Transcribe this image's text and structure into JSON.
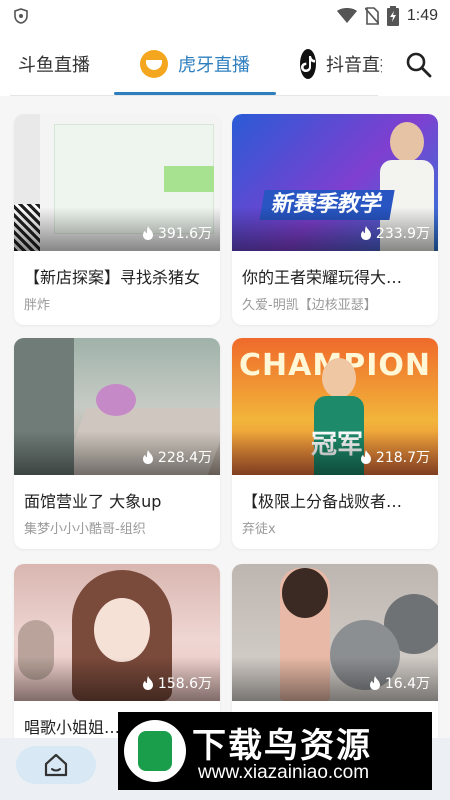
{
  "status_bar": {
    "time": "1:49",
    "icons": [
      "shield-icon",
      "wifi-icon",
      "no-sim-icon",
      "battery-charging-icon"
    ]
  },
  "tabs": [
    {
      "label": "斗鱼直播",
      "icon": "",
      "selected": false
    },
    {
      "label": "虎牙直播",
      "icon": "huya-logo-icon",
      "selected": true
    },
    {
      "label": "抖音直播",
      "icon": "douyin-logo-icon",
      "selected": false
    }
  ],
  "search": {
    "icon": "search-icon"
  },
  "accent_color": "#2f7fbf",
  "cards": [
    {
      "title": "【新店探案】寻找杀猪女",
      "streamer": "胖炸",
      "viewers": "391.6万"
    },
    {
      "title": "你的王者荣耀玩得大…",
      "streamer": "久爱-明凯【边核亚瑟】",
      "viewers": "233.9万",
      "thumb_text": "新赛季教学"
    },
    {
      "title": "面馆营业了 大象up",
      "streamer": "集梦小小小酷哥-组织",
      "viewers": "228.4万"
    },
    {
      "title": "【极限上分备战败者…",
      "streamer": "弃徒x",
      "viewers": "218.7万",
      "thumb_text": "CHAMPION",
      "thumb_text_2": "冠军"
    },
    {
      "title": "唱歌小姐姐…",
      "streamer": "",
      "viewers": "158.6万"
    },
    {
      "title": "",
      "streamer": "",
      "viewers": "16.4万"
    }
  ],
  "bottom_nav": {
    "home_icon": "home-icon"
  },
  "watermark": {
    "title": "下载鸟资源",
    "url": "www.xiazainiao.com"
  }
}
